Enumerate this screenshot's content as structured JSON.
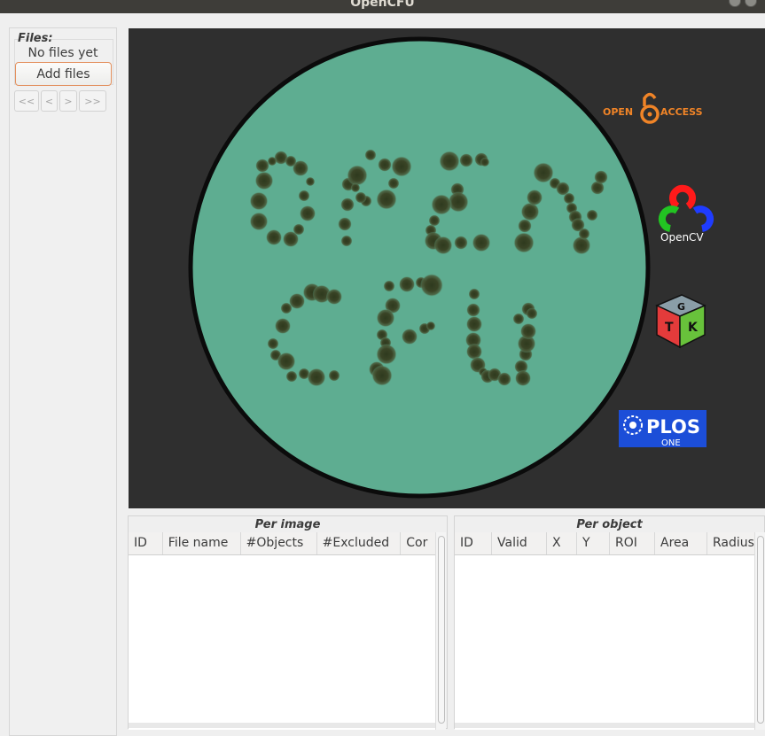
{
  "window": {
    "title": "OpenCFU"
  },
  "sidebar": {
    "files_label": "Files:",
    "files_status": "No files yet",
    "add_files_label": "Add files",
    "nav": {
      "first": "<<",
      "prev": "<",
      "next": ">",
      "last": ">>"
    }
  },
  "logos": {
    "open_access": {
      "left": "OPEN",
      "right": "ACCESS"
    },
    "opencv": "OpenCV",
    "gtk_letters": [
      "G",
      "T",
      "K"
    ],
    "plos": {
      "name": "PLOS",
      "sub": "ONE"
    }
  },
  "per_image": {
    "title": "Per image",
    "columns": [
      "ID",
      "File name",
      "#Objects",
      "#Excluded",
      "Cor"
    ]
  },
  "per_object": {
    "title": "Per object",
    "columns": [
      "ID",
      "Valid",
      "X",
      "Y",
      "ROI",
      "Area",
      "Radius"
    ]
  },
  "colors": {
    "dish_fill": "#5ead91",
    "canvas_bg": "#2f2f2f",
    "accent_orange": "#f08427",
    "plos_blue": "#1c4ed8"
  }
}
